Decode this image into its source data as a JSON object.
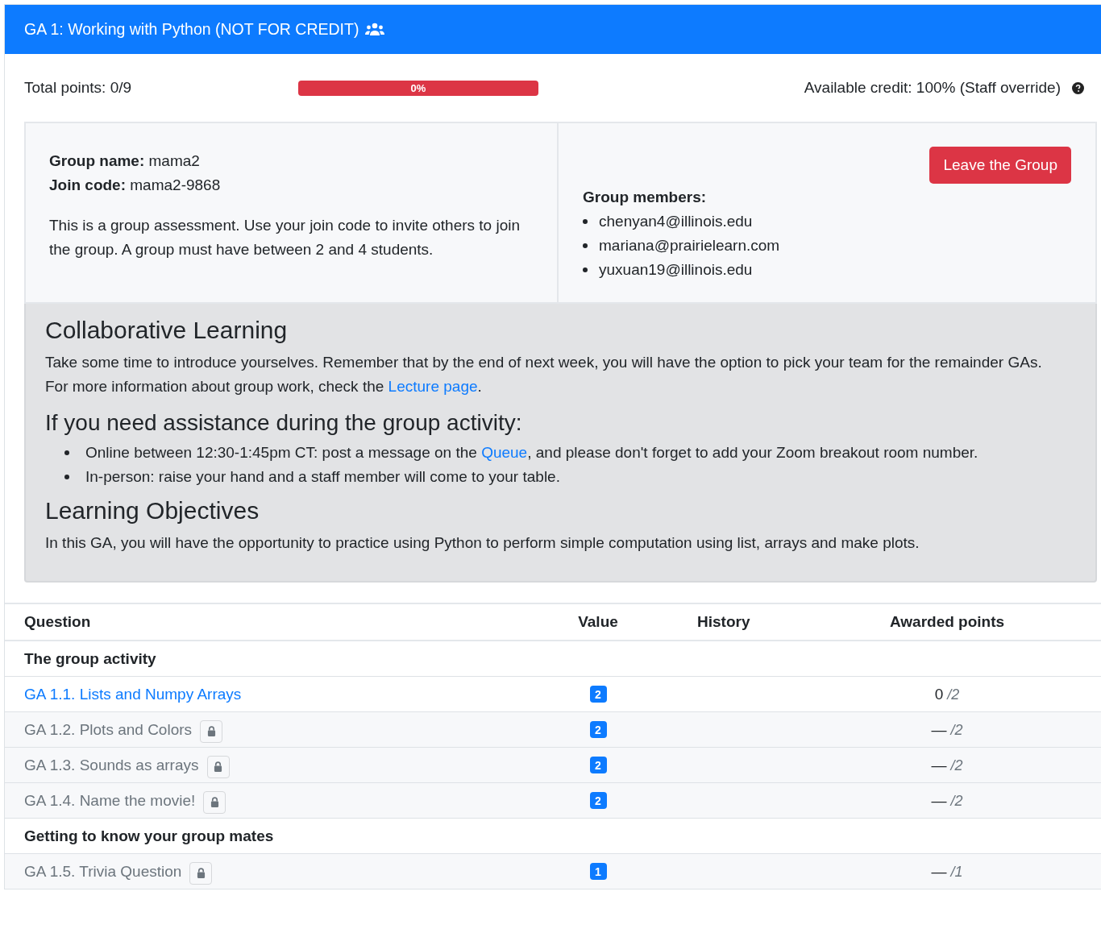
{
  "header": {
    "title": "GA 1: Working with Python (NOT FOR CREDIT)"
  },
  "summary": {
    "total_points": "Total points: 0/9",
    "progress": {
      "level": 0,
      "label": "0%"
    },
    "available_credit": "Available credit: 100% (Staff override)"
  },
  "group": {
    "name_label": "Group name:",
    "name": "mama2",
    "code_label": "Join code:",
    "code": "mama2-9868",
    "description": "This is a group assessment. Use your join code to invite others to join the group. A group must have between 2 and 4 students.",
    "leave_button": "Leave the Group",
    "members_label": "Group members:",
    "members": [
      "chenyan4@illinois.edu",
      "mariana@prairielearn.com",
      "yuxuan19@illinois.edu"
    ]
  },
  "info": [
    {
      "kind": "heading",
      "text": "Collaborative Learning"
    },
    {
      "kind": "paragraph",
      "before": "Take some time to introduce yourselves. Remember that by the end of next week, you will have the option to pick your team for the remainder GAs. For more information about group work, check the ",
      "link": "Lecture page",
      "after": "."
    },
    {
      "kind": "subheading",
      "text": "If you need assistance during the group activity:"
    },
    {
      "kind": "bullets",
      "items": [
        {
          "before": "Online between 12:30-1:45pm CT: post a message on the ",
          "link": "Queue",
          "after": ", and please don't forget to add your Zoom breakout room number."
        },
        {
          "before": "In-person: raise your hand and a staff member will come to your table."
        }
      ]
    },
    {
      "kind": "heading",
      "text": "Learning Objectives"
    },
    {
      "kind": "paragraph",
      "before": "In this GA, you will have the opportunity to practice using Python to perform simple computation using list, arrays and make plots."
    }
  ],
  "table": {
    "columns": [
      "Question",
      "Value",
      "History",
      "Awarded points"
    ],
    "rows": [
      {
        "kind": "section",
        "title": "The group activity"
      },
      {
        "kind": "question",
        "title": "GA 1.1. Lists and Numpy Arrays",
        "locked": false,
        "value": "2",
        "awarded": "0",
        "max": "/2"
      },
      {
        "kind": "question",
        "title": "GA 1.2. Plots and Colors",
        "locked": true,
        "value": "2",
        "awarded": "—",
        "max": "/2"
      },
      {
        "kind": "question",
        "title": "GA 1.3. Sounds as arrays",
        "locked": true,
        "value": "2",
        "awarded": "—",
        "max": "/2"
      },
      {
        "kind": "question",
        "title": "GA 1.4. Name the movie!",
        "locked": true,
        "value": "2",
        "awarded": "—",
        "max": "/2"
      },
      {
        "kind": "section",
        "title": "Getting to know your group mates"
      },
      {
        "kind": "question",
        "title": "GA 1.5. Trivia Question",
        "locked": true,
        "value": "1",
        "awarded": "—",
        "max": "/1"
      }
    ]
  }
}
